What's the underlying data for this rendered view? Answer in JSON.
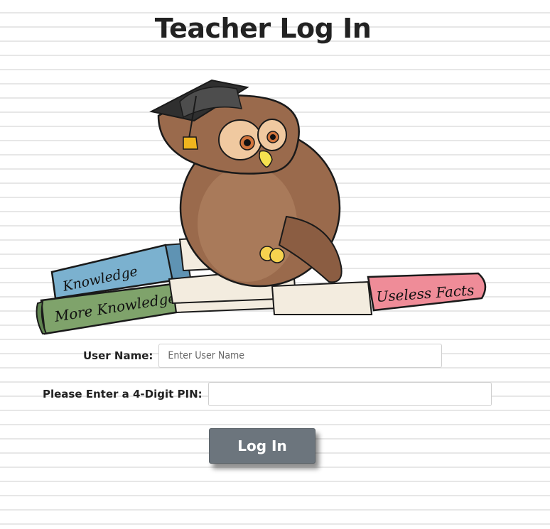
{
  "page": {
    "title": "Teacher Log In"
  },
  "mascot": {
    "icon": "owl-graduate-illustration",
    "books": [
      "Knowledge",
      "More Knowledge",
      "Useless Facts"
    ]
  },
  "form": {
    "username_label": "User Name:",
    "username_placeholder": "Enter User Name",
    "pin_label": "Please Enter a 4-Digit PIN:",
    "pin_placeholder": ""
  },
  "actions": {
    "login_label": "Log In"
  },
  "colors": {
    "background": "#ffffff",
    "lines": "#e7e7e7",
    "button": "#6c757d",
    "title": "#222222"
  }
}
